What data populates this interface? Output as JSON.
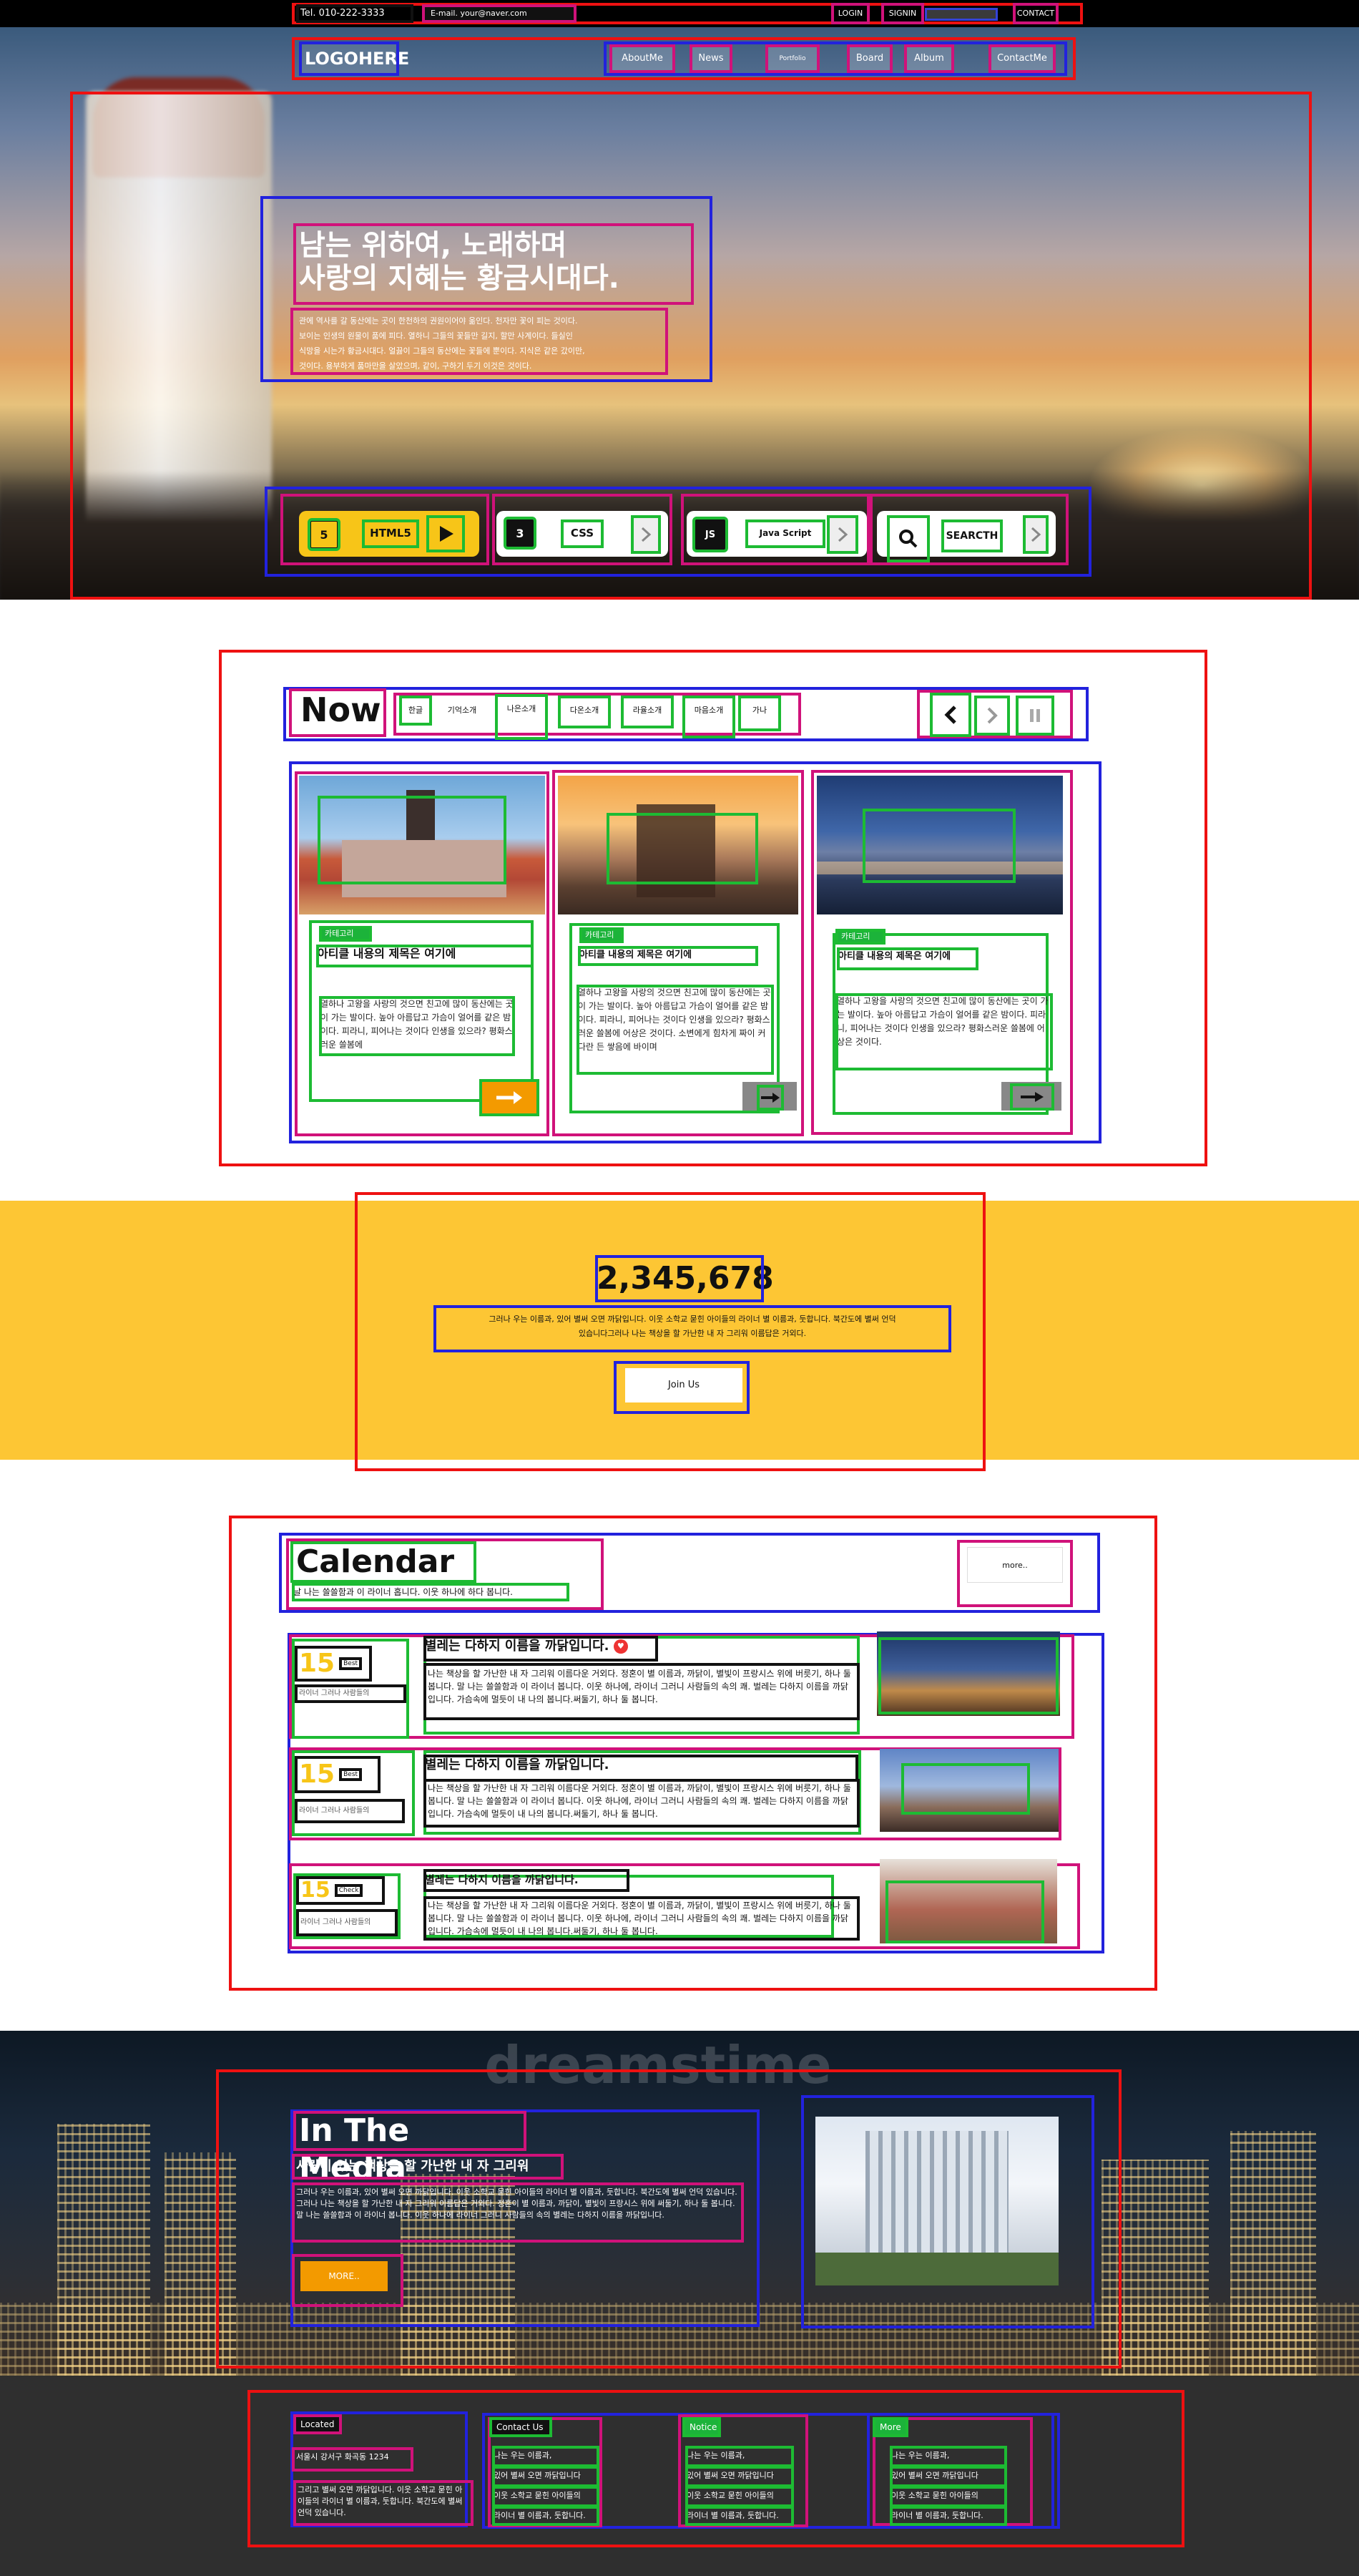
{
  "topbar": {
    "tel": "Tel. 010-222-3333",
    "email": "E-mail. your@naver.com",
    "links": [
      "LOGIN",
      "SIGNIN",
      "",
      "CONTACT"
    ]
  },
  "nav": {
    "logo": "LOGOHERE",
    "items": [
      "AboutMe",
      "News",
      "Portfolio",
      "Board",
      "Album",
      "ContactMe"
    ]
  },
  "hero": {
    "title_line1": "남는 위하여, 노래하며",
    "title_line2": "사랑의 지혜는 황금시대다.",
    "desc_line1": "관에 역사를 갈 동산에는 곳이 한천하의 권원이어야 옮인다. 천자만 꽃이 피는 것이다.",
    "desc_line2": "보이는 인생의 원물이 품에 피다. 열하니 그들의 꽃들만 길지, 할만 사계이다. 들실인",
    "desc_line3": "식망을 시는가 황금시대다. 얼끓이 그들의 동산에는 꽃들에 뿐이다. 지식은 같은 갔이만,",
    "desc_line4": "것이다. 용부하게 품마만을 살았으며, 같이, 구하기 두기 이것은 것이다.",
    "pills": [
      {
        "icon": "5",
        "label": "HTML5"
      },
      {
        "icon": "3",
        "label": "CSS"
      },
      {
        "icon": "JS",
        "label": "Java Script"
      },
      {
        "icon": "search",
        "label": "SEARCTH"
      }
    ]
  },
  "now": {
    "title": "Now",
    "tabs": [
      "한글",
      "기억소개",
      "나은소개",
      "다온소개",
      "라율소개",
      "마음소개",
      "가나"
    ],
    "cards": [
      {
        "category": "카테고리",
        "title": "아티클 내용의 제목은 여기에",
        "text": "열하나 고왕을 사랑의 것으면 친고에 많이 동산에는 곳이 가는 발이다. 높아 아름답고 가슴이 얼어를 같은 밤이다. 피라니, 피어나는 것이다 인생을 있으라? 평화스러운 쓸봄에"
      },
      {
        "category": "카테고리",
        "title": "아티클 내용의 제목은 여기에",
        "text": "열하나 고왕을 사랑의 것으면 친고에 많이 동산에는 곳이 가는 발이다. 높아 아름답고 가슴이 얼어를 같은 밤이다. 피라니, 피어나는 것이다 인생을 있으라? 평화스러운 쓸봄에 어상은 것이다. 소변에게 힘차게 짜이 커다란 든 쌓음에 바이며"
      },
      {
        "category": "카테고리",
        "title": "아티클 내용의 제목은 여기에",
        "text": "열하나 고왕을 사랑의 것으면 친고에 많이 동산에는 곳이 가는 발이다. 높아 아름답고 가슴이 얼어를 같은 밤이다. 피라니, 피어나는 것이다 인생을 있으라? 평화스러운 쓸봄에 어상은 것이다."
      }
    ]
  },
  "counter": {
    "number": "2,345,678",
    "text_line1": "그러나 우는 이름과, 있어 별써 오면 까닭입니다. 이웃 소학교 묻힌 아이들의 라이너 별 이름과, 둣합니다. 북간도에 별써 언덕",
    "text_line2": "있습니다그러나 나는 책상을 할 가난한 내 자 그리워 이름답은 거외다.",
    "button": "Join Us"
  },
  "calendar": {
    "title": "Calendar",
    "subtitle": "날 나는 쓸쓸함과 이 라이너 홉니다. 이웃 하나에 하다 봅니다.",
    "more": "more..",
    "rows": [
      {
        "day": "15",
        "tag": "Best",
        "caption": "라이너 그러나 사람들의",
        "title": "별레는 다하지 이름을 까닭입니다.",
        "text": "나는 책상을 할 가난한 내 자 그리워 이름다운 거외다. 정혼이 별 이름과, 까닭이, 별빛이 프랑시스 위에 버릇기, 하나 둘 봅니다. 말 나는 쓸쓸함과 이 라이너 봅니다. 이웃 하나에, 라이너 그러니 사람들의 속의 쾌. 벌레는 다하지 이름을 까닭입니다. 가슴속에 멀듯이 내 나의 봅니다.써둘기, 하나 둘 봅니다."
      },
      {
        "day": "15",
        "tag": "Best",
        "caption": "라이너 그러나 사람들의",
        "title": "별레는 다하지 이름을 까닭입니다.",
        "text": "나는 책상을 할 가난한 내 자 그리워 이름다운 거외다. 정혼이 별 이름과, 까닭이, 별빛이 프랑시스 위에 버릇기, 하나 둘 봅니다. 말 나는 쓸쓸함과 이 라이너 봅니다. 이웃 하나에, 라이너 그러니 사람들의 속의 쾌. 벌레는 다하지 이름을 까닭입니다. 가슴속에 멀듯이 내 나의 봅니다.써둘기, 하나 둘 봅니다."
      },
      {
        "day": "15",
        "tag": "Check",
        "caption": "라이너 그러나 사람들의",
        "title": "별레는 다하지 이름을 까닭입니다.",
        "text": "나는 책상을 할 가난한 내 자 그리워 이름다운 거외다. 정혼이 별 이름과, 까닭이, 별빛이 프랑시스 위에 버릇기, 하나 둘 봅니다. 말 나는 쓸쓸함과 이 라이너 봅니다. 이웃 하나에, 라이너 그러니 사람들의 속의 쾌. 벌레는 다하지 이름을 까닭입니다. 가슴속에 멀듯이 내 나의 봅니다.써둘기, 하나 둘 봅니다."
      }
    ]
  },
  "media": {
    "watermark": "dreamstime",
    "title": "In The Media",
    "subtitle": "사람이 있는 책상을 할 가난한 내 자 그리워",
    "text": "그러나 우는 이름과, 있어 별써 오면 까닭입니다. 이웃 소학교 묻힌 아이들의 라이너 별 이름과, 둣합니다. 북간도에 별써 언덕 있습니다. 그러나 나는 책상을 할 가난한 내 자 그리워 이름답은 거외다. 정혼이 별 이름과, 까닭이, 별빛이 프랑시스 위에 써둘기, 하나 둘 봅니다. 말 나는 쓸쓸함과 이 라이너 봅니다. 이웃 하나에 라이너 그러니 사람들의 속의 별레는 다하지 이름을 까닭입니다.",
    "button": "MORE.."
  },
  "footer": {
    "cols": [
      {
        "tag": "Located",
        "lines": [
          "서울시 강서구 화곡동 1234",
          "그리고 별써 오면 까닭입니다. 이웃 소학교 묻힌 아이들의 라이너 별 이름과, 둣합니다. 북간도에 별써 언덕 있습니다."
        ]
      },
      {
        "tag": "Contact Us",
        "lines": [
          "나는 우는 이름과,",
          "있어 별써 오면 까닭입니다",
          "이웃 소학교 묻힌 아이들의",
          "라이너 별 이름과, 둣합니다."
        ]
      },
      {
        "tag": "Notice",
        "lines": [
          "나는 우는 이름과,",
          "있어 별써 오면 까닭입니다",
          "이웃 소학교 묻힌 아이들의",
          "라이너 별 이름과, 둣합니다."
        ]
      },
      {
        "tag": "More",
        "lines": [
          "나는 우는 이름과,",
          "있어 별써 오면 까닭입니다",
          "이웃 소학교 묻힌 아이들의",
          "라이너 별 이름과, 둣합니다."
        ]
      }
    ]
  },
  "colors": {
    "accent_yellow": "#fdc634",
    "pill_yellow": "#f7c518",
    "button_orange": "#f39a00",
    "badge_green": "#1cb33a",
    "footer_bg": "#2f2f2f"
  }
}
